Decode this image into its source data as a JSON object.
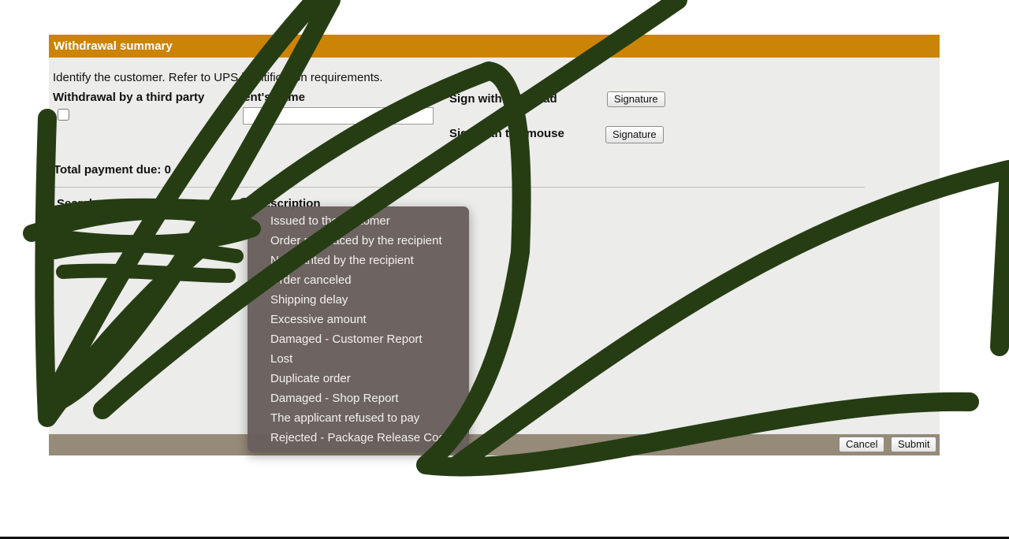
{
  "panel": {
    "title": "Withdrawal summary",
    "intro": "Identify the customer. Refer to UPS identification requirements.",
    "third_party_label": "Withdrawal by a third party",
    "client_name_label": "Client's name",
    "sign_pad_label": "Sign with signepad",
    "sign_mouse_label": "Sign with the mouse",
    "signature_button": "Signature",
    "total_payment_label": "Total payment due: 0",
    "search_column": "Search",
    "description_column": "Description"
  },
  "dropdown": {
    "items": [
      "Issued to the customer",
      "Order not placed by the recipient",
      "Not wanted by the recipient",
      "Order canceled",
      "Shipping delay",
      "Excessive amount",
      "Damaged - Customer Report",
      "Lost",
      "Duplicate order",
      "Damaged - Shop Report",
      "The applicant refused to pay",
      "Rejected - Package Release Code"
    ]
  },
  "footer": {
    "cancel": "Cancel",
    "submit": "Submit"
  },
  "colors": {
    "header": "#cb8405",
    "panel": "#ececea",
    "footer": "#968a79",
    "dropdown": "#685f5d",
    "scribble": "#263d14"
  }
}
